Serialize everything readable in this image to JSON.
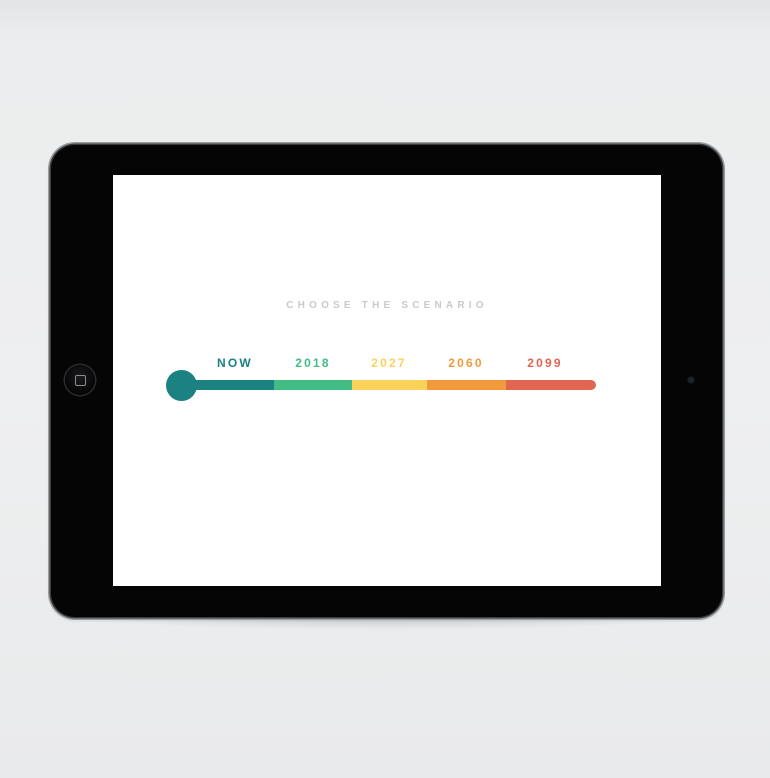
{
  "screen": {
    "heading": "CHOOSE THE SCENARIO"
  },
  "slider": {
    "selected_index": 0,
    "stops": [
      {
        "label": "NOW",
        "color": "#1b8181"
      },
      {
        "label": "2018",
        "color": "#43bb85"
      },
      {
        "label": "2027",
        "color": "#fbd25a"
      },
      {
        "label": "2060",
        "color": "#f19a3c"
      },
      {
        "label": "2099",
        "color": "#e06651"
      }
    ]
  },
  "device": {
    "home_button_icon": "home-square-icon",
    "camera_icon": "front-camera-icon"
  }
}
